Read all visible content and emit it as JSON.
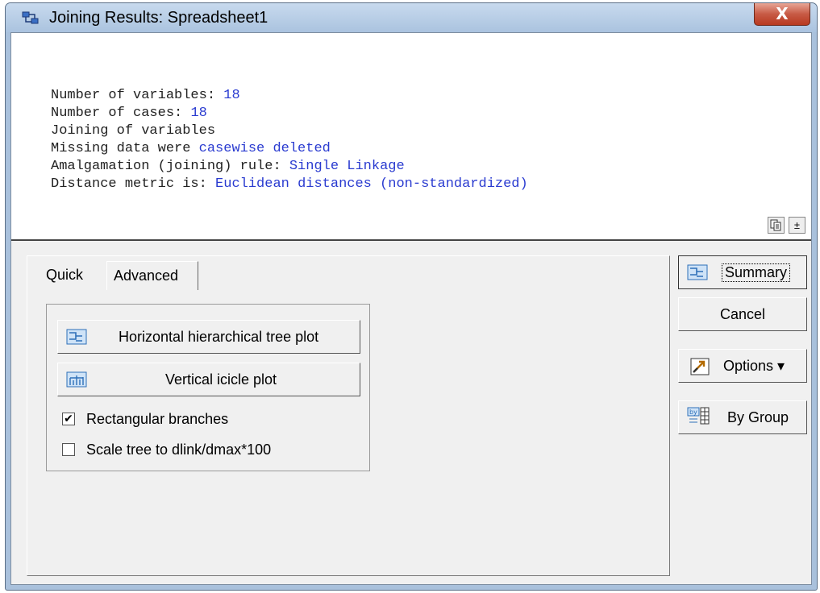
{
  "window": {
    "title": "Joining Results: Spreadsheet1",
    "close_label": "X"
  },
  "report": {
    "lines": [
      {
        "label": "Number of variables: ",
        "value": "18"
      },
      {
        "label": "Number of cases: ",
        "value": "18"
      },
      {
        "label": "Joining of variables",
        "value": ""
      },
      {
        "label": "Missing data were ",
        "value": "casewise deleted"
      },
      {
        "label": "Amalgamation (joining) rule: ",
        "value": "Single Linkage"
      },
      {
        "label": "Distance metric is: ",
        "value": "Euclidean distances (non-standardized)"
      }
    ],
    "toolbar": {
      "copy_icon": "copy-icon",
      "expand_label": "±"
    }
  },
  "tabs": [
    {
      "label": "Quick"
    },
    {
      "label": "Advanced"
    }
  ],
  "quick": {
    "horizontal_tree_label": "Horizontal hierarchical tree plot",
    "vertical_icicle_label": "Vertical icicle plot",
    "rectangular_branches": {
      "label": "Rectangular branches",
      "checked": true
    },
    "scale_tree": {
      "label": "Scale tree to dlink/dmax*100",
      "checked": false
    }
  },
  "sidebar": {
    "summary_label": "Summary",
    "cancel_label": "Cancel",
    "options_label": "Options ▾",
    "by_group_label": "By Group"
  },
  "colors": {
    "value_blue": "#2a3bd0",
    "close_red": "#c75a45",
    "title_bar": "#aac3df"
  }
}
